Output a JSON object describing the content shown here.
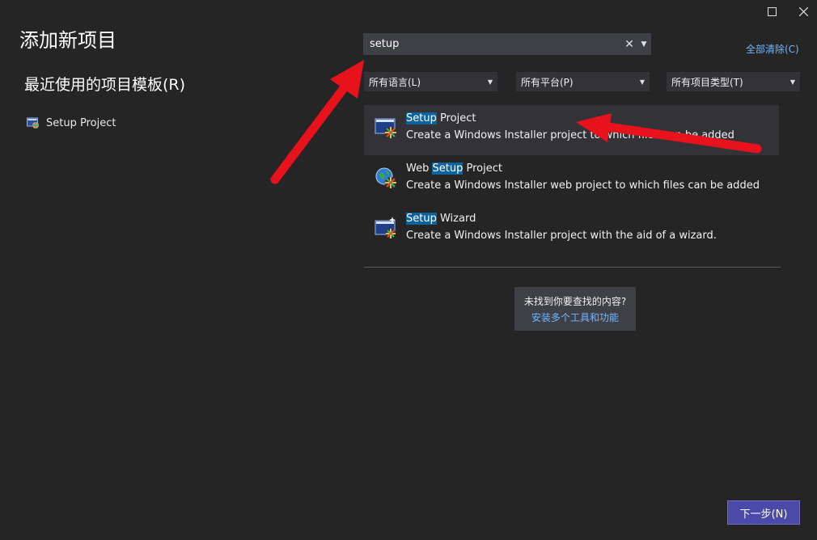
{
  "window": {
    "title": "添加新项目",
    "maximize_icon": "maximize-icon",
    "close_icon": "close-icon"
  },
  "recent": {
    "title": "最近使用的项目模板(R)",
    "items": [
      {
        "label": "Setup Project",
        "icon": "setup-project-icon"
      }
    ]
  },
  "search": {
    "value": "setup",
    "clear_icon": "clear-icon",
    "dropdown_icon": "chevron-down-icon"
  },
  "clear_all": "全部清除(C)",
  "filters": {
    "language": "所有语言(L)",
    "platform": "所有平台(P)",
    "project_type": "所有项目类型(T)"
  },
  "results": [
    {
      "name_pre": "",
      "name_hl": "Setup",
      "name_post": " Project",
      "desc": "Create a Windows Installer project to which files can be added",
      "icon": "setup-project-icon"
    },
    {
      "name_pre": "Web ",
      "name_hl": "Setup",
      "name_post": " Project",
      "desc": "Create a Windows Installer web project to which files can be added",
      "icon": "web-setup-project-icon"
    },
    {
      "name_pre": "",
      "name_hl": "Setup",
      "name_post": " Wizard",
      "desc": "Create a Windows Installer project with the aid of a wizard.",
      "icon": "setup-wizard-icon"
    }
  ],
  "not_found": {
    "question": "未找到你要查找的内容?",
    "link": "安装多个工具和功能"
  },
  "next_button": "下一步(N)",
  "colors": {
    "background": "#252526",
    "accent": "#0e639c",
    "link": "#6fb8ff",
    "next_button": "#4c4aa8",
    "annotation_arrow": "#e8121c"
  }
}
